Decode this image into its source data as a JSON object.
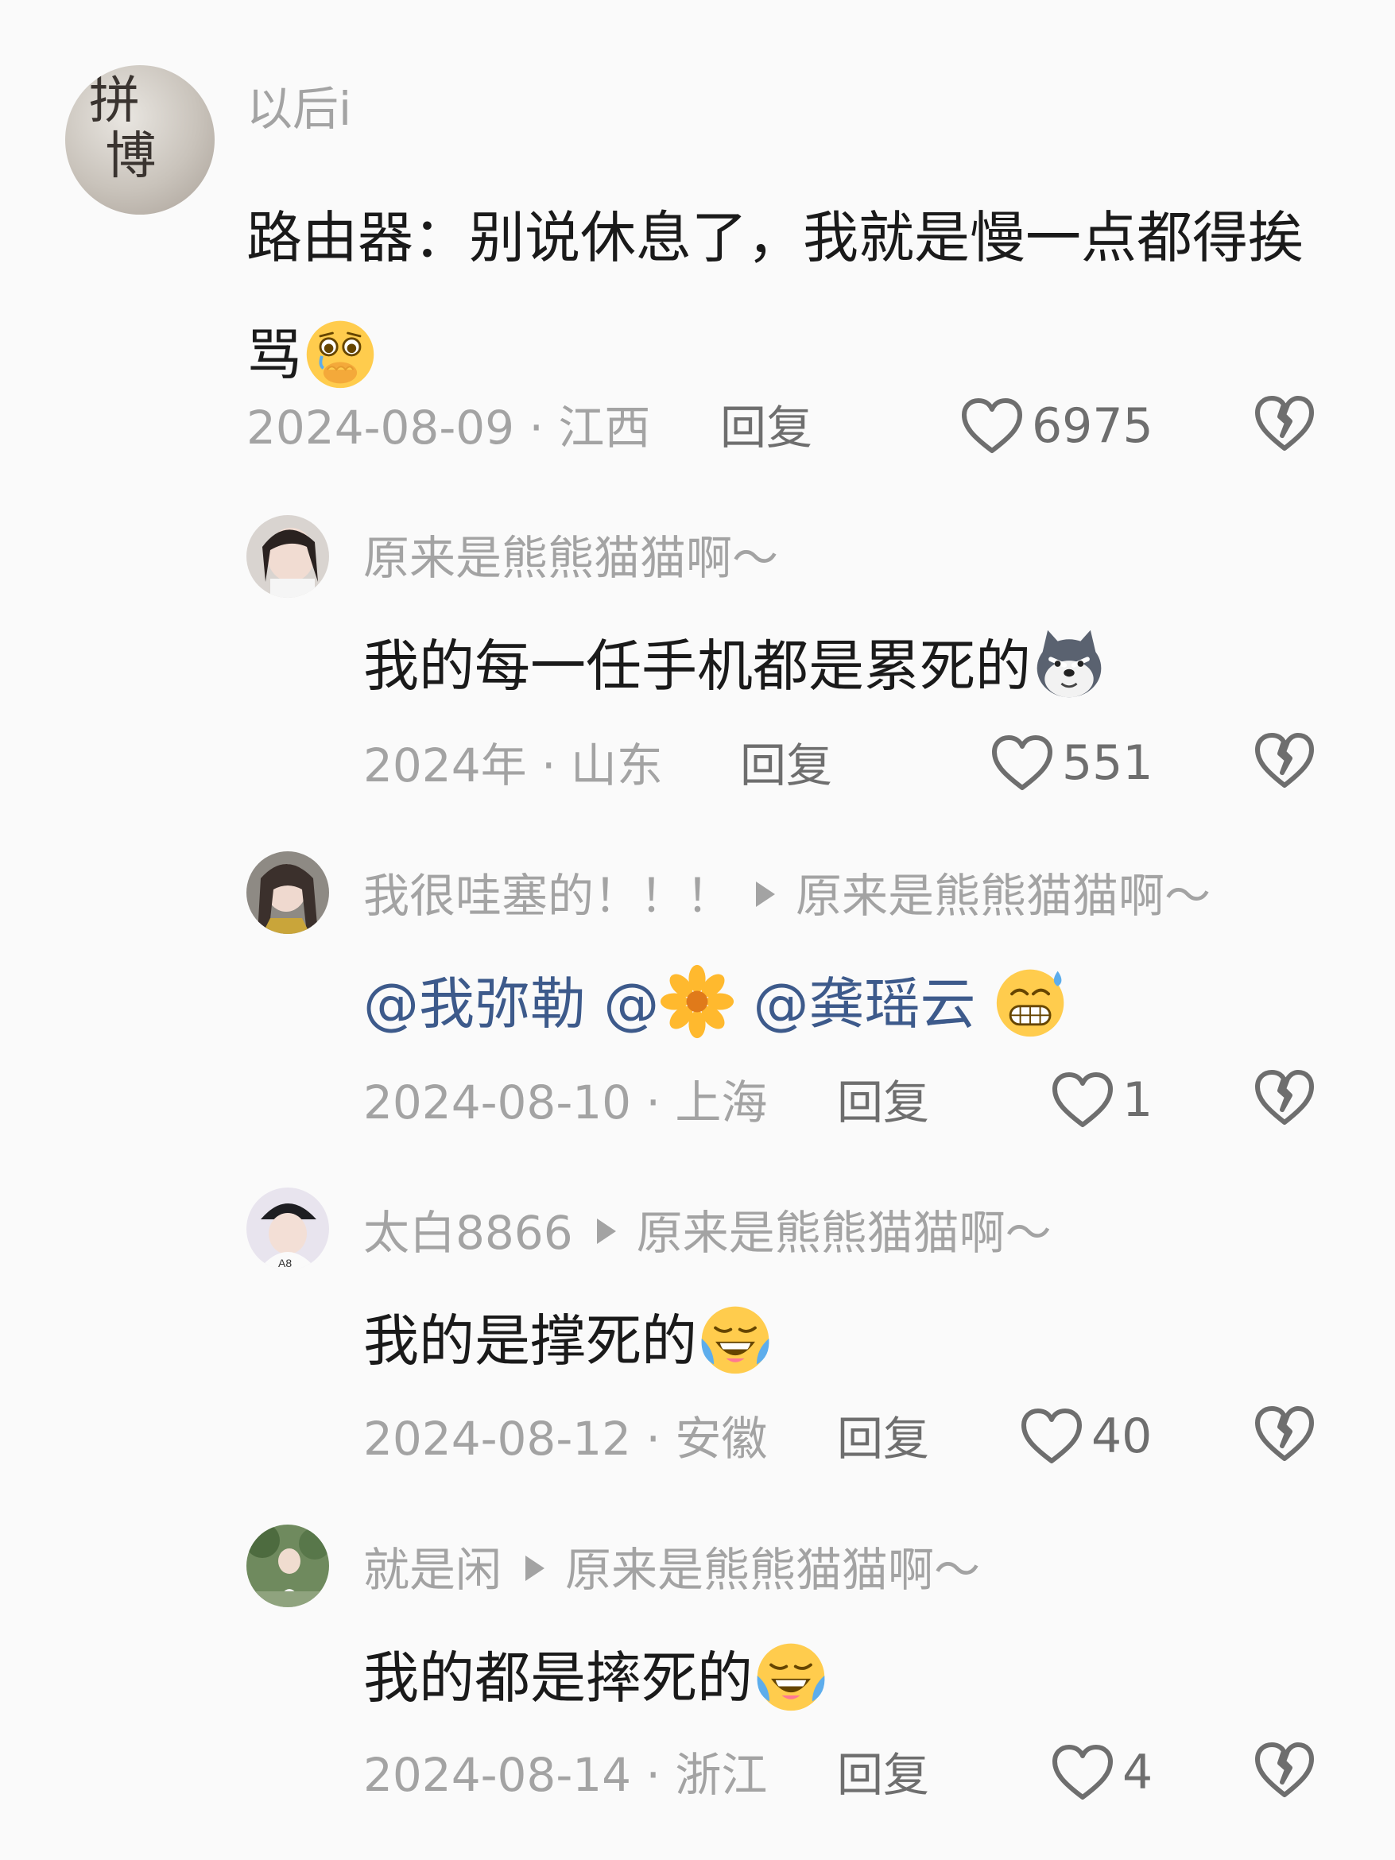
{
  "colors": {
    "background": "#fafafa",
    "text": "#1a1a1a",
    "muted": "#a3a3a3",
    "mention": "#3d5a8b"
  },
  "comments": [
    {
      "username": "以后i",
      "avatar_text": "拼\n 博",
      "content": "路由器：别说休息了，我就是慢一点都得挨骂",
      "emoji": "crying-face-emoji",
      "date": "2024-08-09",
      "location": "江西",
      "reply_label": "回复",
      "likes": "6975"
    },
    {
      "username": "原来是熊熊猫猫啊～",
      "content": "我的每一任手机都是累死的",
      "emoji": "husky-dog-emoji",
      "date": "2024年",
      "location": "山东",
      "reply_label": "回复",
      "likes": "551"
    },
    {
      "username": "我很哇塞的！！！",
      "reply_to": "原来是熊熊猫猫啊～",
      "mentions": [
        "@我弥勒",
        "@",
        "@龚瑶云"
      ],
      "emoji": "grimacing-sweat-emoji",
      "date": "2024-08-10",
      "location": "上海",
      "reply_label": "回复",
      "likes": "1"
    },
    {
      "username": "太白8866",
      "reply_to": "原来是熊熊猫猫啊～",
      "content": "我的是撑死的",
      "emoji": "laughing-crying-emoji",
      "date": "2024-08-12",
      "location": "安徽",
      "reply_label": "回复",
      "likes": "40"
    },
    {
      "username": "就是闲",
      "reply_to": "原来是熊熊猫猫啊～",
      "content": "我的都是摔死的",
      "emoji": "laughing-crying-emoji",
      "date": "2024-08-14",
      "location": "浙江",
      "reply_label": "回复",
      "likes": "4"
    }
  ]
}
